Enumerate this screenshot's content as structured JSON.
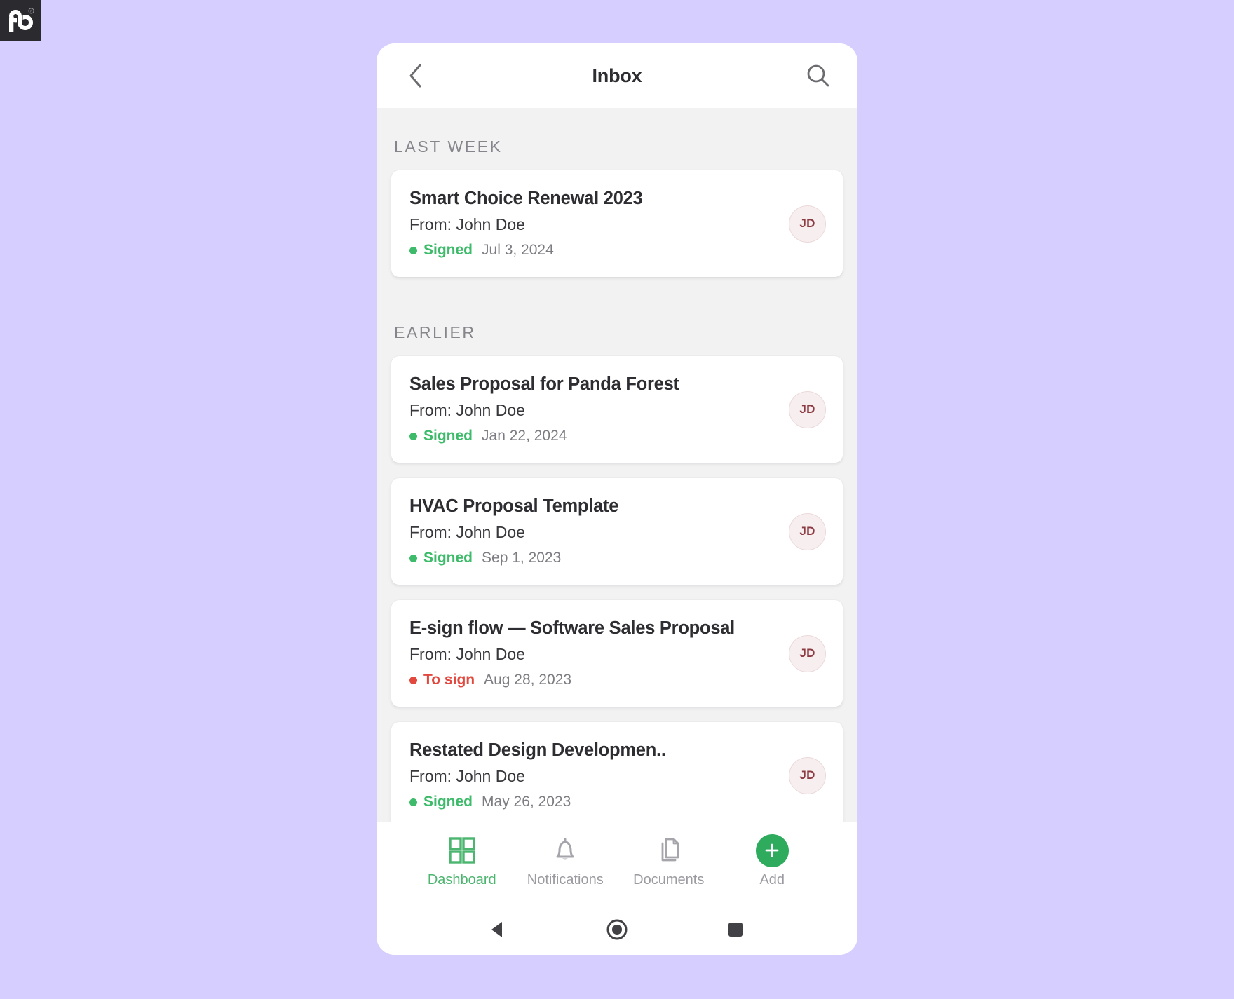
{
  "brand": {
    "logo_icon": "pandadoc-logo",
    "logo_text": "pd",
    "registered_mark": "®"
  },
  "header": {
    "title": "Inbox",
    "back_icon": "chevron-left-icon",
    "search_icon": "search-icon"
  },
  "sections": [
    {
      "label": "LAST WEEK",
      "items": [
        {
          "title": "Smart Choice Renewal 2023",
          "from": "From: John Doe",
          "status": "Signed",
          "status_color": "#3dbb6a",
          "date": "Jul 3, 2024",
          "avatar": "JD"
        }
      ]
    },
    {
      "label": "EARLIER",
      "items": [
        {
          "title": "Sales Proposal for Panda Forest",
          "from": "From: John Doe",
          "status": "Signed",
          "status_color": "#3dbb6a",
          "date": "Jan 22, 2024",
          "avatar": "JD"
        },
        {
          "title": "HVAC Proposal Template",
          "from": "From: John Doe",
          "status": "Signed",
          "status_color": "#3dbb6a",
          "date": "Sep 1, 2023",
          "avatar": "JD"
        },
        {
          "title": "E-sign flow — Software Sales Proposal",
          "from": "From: John Doe",
          "status": "To sign",
          "status_color": "#e2483e",
          "date": "Aug 28, 2023",
          "avatar": "JD"
        },
        {
          "title": "Restated Design Developmen..",
          "from": "From: John Doe",
          "status": "Signed",
          "status_color": "#3dbb6a",
          "date": "May 26, 2023",
          "avatar": "JD"
        }
      ]
    }
  ],
  "bottom_nav": {
    "items": [
      {
        "label": "Dashboard",
        "icon": "grid-icon",
        "active": true
      },
      {
        "label": "Notifications",
        "icon": "bell-icon",
        "active": false
      },
      {
        "label": "Documents",
        "icon": "documents-icon",
        "active": false
      },
      {
        "label": "Add",
        "icon": "plus-icon",
        "active": false
      }
    ],
    "active_color": "#4cb56f",
    "inactive_color": "#9a9aa0",
    "fab_color": "#2fab5e"
  },
  "system_nav": {
    "back_icon": "android-back-icon",
    "home_icon": "android-home-icon",
    "recents_icon": "android-recents-icon"
  },
  "colors": {
    "page_background": "#d5ceff",
    "list_background": "#f2f2f2",
    "card_background": "#ffffff",
    "peek_card_background": "#fcefe0"
  }
}
